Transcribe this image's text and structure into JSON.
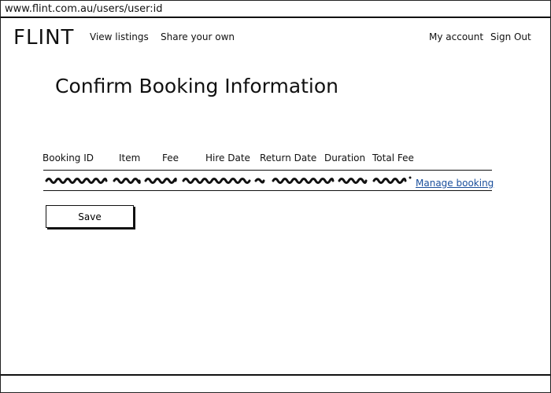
{
  "browser": {
    "url": "www.flint.com.au/users/user:id"
  },
  "nav": {
    "logo": "FLINT",
    "links": [
      {
        "label": "View listings"
      },
      {
        "label": "Share your own"
      }
    ],
    "right_links": [
      {
        "label": "My account"
      },
      {
        "label": "Sign Out"
      }
    ]
  },
  "page": {
    "title": "Confirm Booking Information"
  },
  "table": {
    "columns": [
      "Booking ID",
      "Item",
      "Fee",
      "Hire Date",
      "Return Date",
      "Duration",
      "Total Fee"
    ],
    "row": {
      "manage_label": "Manage booking"
    }
  },
  "actions": {
    "save_label": "Save"
  }
}
